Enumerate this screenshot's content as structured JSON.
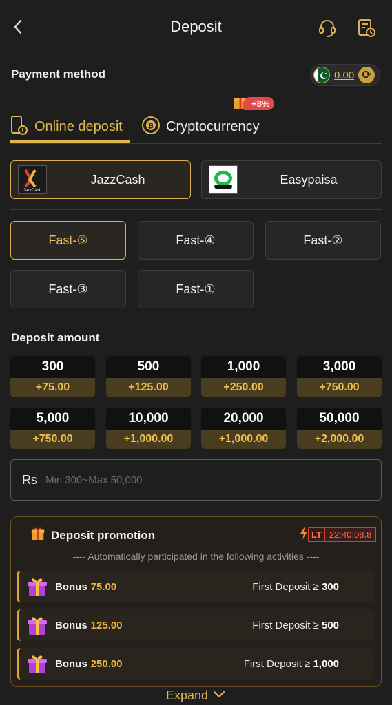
{
  "header": {
    "title": "Deposit"
  },
  "payment_method": {
    "label": "Payment method",
    "balance": "0.00"
  },
  "tabs": [
    {
      "label": "Online deposit",
      "active": true
    },
    {
      "label": "Cryptocurrency",
      "active": false,
      "badge": "+8%"
    }
  ],
  "channels": [
    {
      "name": "JazzCash",
      "logo_text": "JazzCash",
      "active": true
    },
    {
      "name": "Easypaisa",
      "active": false
    }
  ],
  "fast_options": [
    {
      "label": "Fast-⑤",
      "active": true
    },
    {
      "label": "Fast-④",
      "active": false
    },
    {
      "label": "Fast-②",
      "active": false
    },
    {
      "label": "Fast-③",
      "active": false
    },
    {
      "label": "Fast-①",
      "active": false
    }
  ],
  "deposit_amount": {
    "label": "Deposit amount",
    "tiles": [
      {
        "amount": "300",
        "bonus": "+75.00"
      },
      {
        "amount": "500",
        "bonus": "+125.00"
      },
      {
        "amount": "1,000",
        "bonus": "+250.00"
      },
      {
        "amount": "3,000",
        "bonus": "+750.00"
      },
      {
        "amount": "5,000",
        "bonus": "+750.00"
      },
      {
        "amount": "10,000",
        "bonus": "+1,000.00"
      },
      {
        "amount": "20,000",
        "bonus": "+1,000.00"
      },
      {
        "amount": "50,000",
        "bonus": "+2,000.00"
      }
    ],
    "currency": "Rs",
    "placeholder": "Min 300~Max 50,000"
  },
  "promotion": {
    "title": "Deposit promotion",
    "lt_label": "LT",
    "timer": "22:40:08.8",
    "subtitle": "---- Automatically participated in the following activities ----",
    "rows": [
      {
        "label": "Bonus",
        "value": "75.00",
        "condition_text": "First Deposit ≥",
        "condition_value": "300"
      },
      {
        "label": "Bonus",
        "value": "125.00",
        "condition_text": "First Deposit ≥",
        "condition_value": "500"
      },
      {
        "label": "Bonus",
        "value": "250.00",
        "condition_text": "First Deposit ≥",
        "condition_value": "1,000"
      }
    ],
    "expand_label": "Expand"
  },
  "colors": {
    "accent": "#e0b84e",
    "background": "#1e1e1f",
    "bonus_orange": "#f0b43a",
    "timer_red": "#ff6b55"
  }
}
